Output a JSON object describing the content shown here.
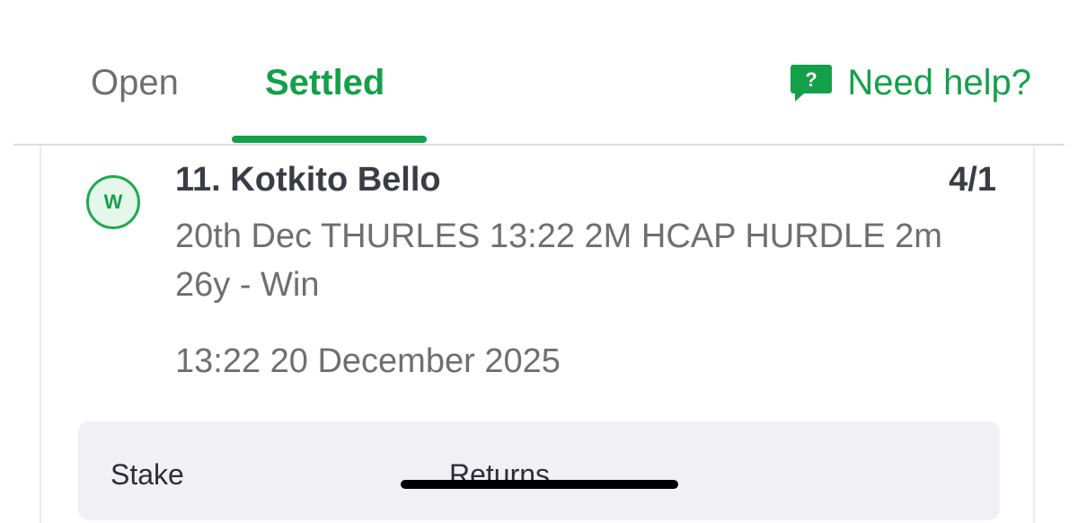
{
  "tabs": {
    "open_label": "Open",
    "settled_label": "Settled",
    "active": "Settled"
  },
  "help": {
    "label": "Need help?",
    "icon": "help-chat-bubble-icon",
    "icon_glyph": "?"
  },
  "bet": {
    "result_badge": "W",
    "selection": "11. Kotkito Bello",
    "odds": "4/1",
    "market": "20th Dec THURLES 13:22 2M HCAP HURDLE 2m 26y - Win",
    "datetime": "13:22 20 December 2025"
  },
  "summary": {
    "stake_label": "Stake",
    "returns_label": "Returns"
  },
  "colors": {
    "accent": "#14a04a",
    "text_primary": "#3b3c46",
    "text_secondary": "#6f6f73",
    "summary_bg": "#f1f1f5"
  }
}
